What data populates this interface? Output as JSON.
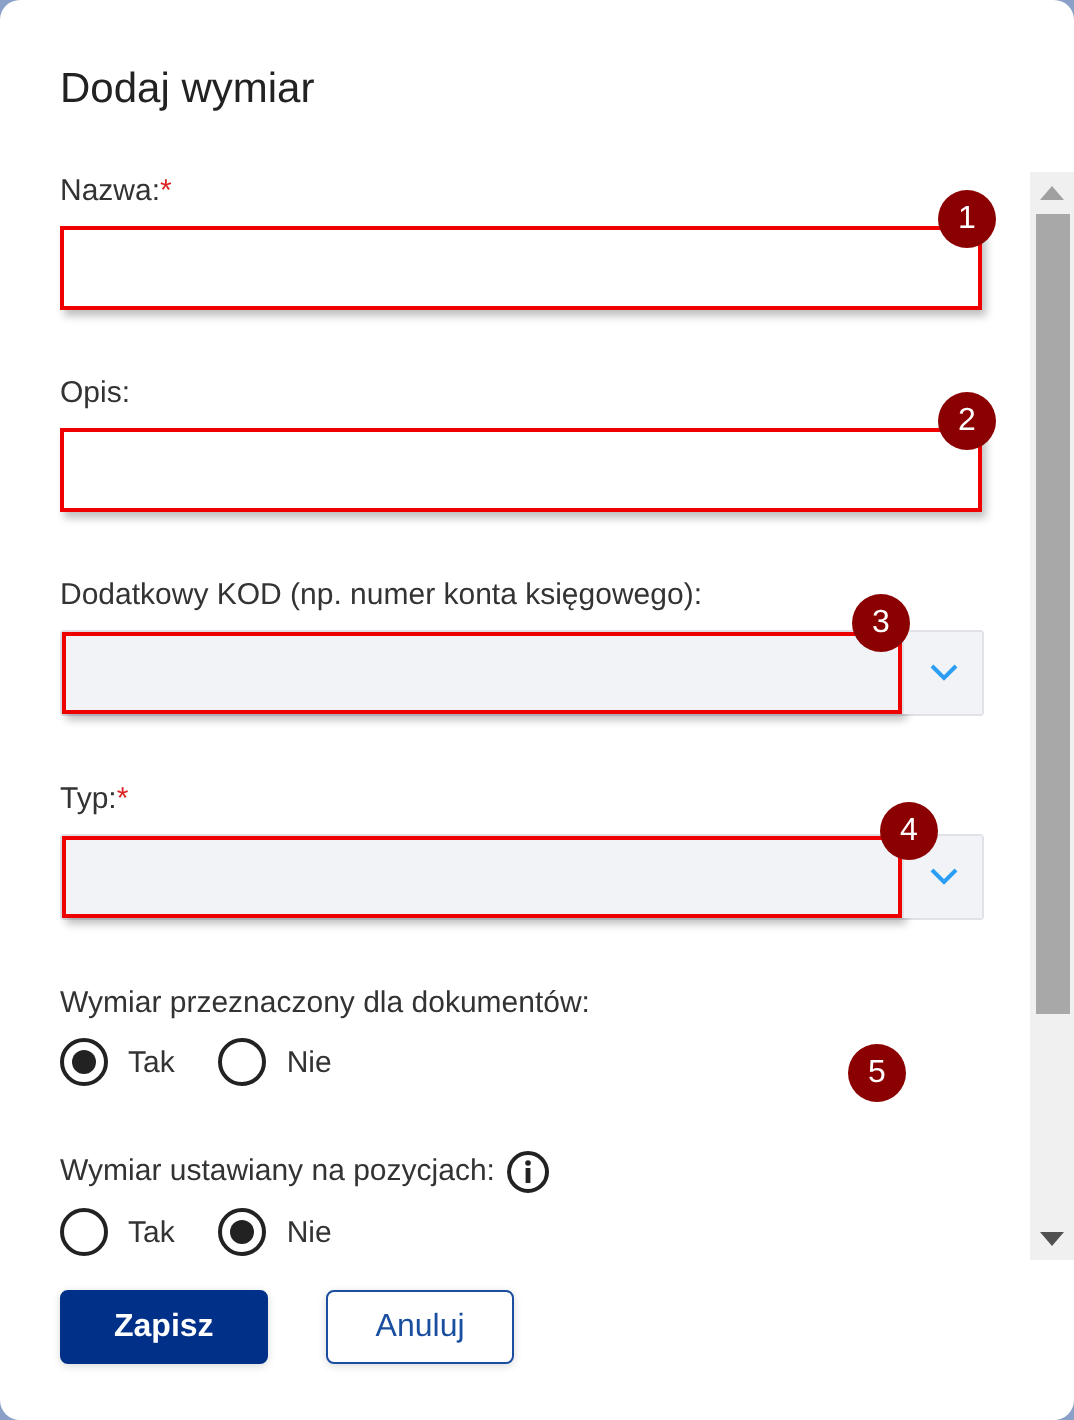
{
  "dialog": {
    "title": "Dodaj wymiar"
  },
  "fields": [
    {
      "kind": "text",
      "label": "Nazwa:",
      "required_mark": "*",
      "highlighted": true,
      "badge": "1"
    },
    {
      "kind": "text",
      "label": "Opis:",
      "highlighted": true,
      "badge": "2"
    },
    {
      "kind": "dropdown",
      "label": "Dodatkowy KOD (np. numer konta księgowego):",
      "highlighted": true,
      "badge": "3"
    },
    {
      "kind": "dropdown",
      "label": "Typ:",
      "required_mark": "*",
      "highlighted": true,
      "badge": "4"
    }
  ],
  "radio_groups": [
    {
      "label": "Wymiar przeznaczony dla dokumentów:",
      "info_icon": false,
      "badge": "5",
      "options": [
        {
          "label": "Tak",
          "selected": true
        },
        {
          "label": "Nie",
          "selected": false
        }
      ]
    },
    {
      "label": "Wymiar ustawiany na pozycjach:",
      "info_icon": true,
      "options": [
        {
          "label": "Tak",
          "selected": false
        },
        {
          "label": "Nie",
          "selected": true
        }
      ]
    }
  ],
  "buttons": [
    {
      "label": "Zapisz",
      "kind": "primary"
    },
    {
      "label": "Anuluj",
      "kind": "secondary"
    }
  ]
}
